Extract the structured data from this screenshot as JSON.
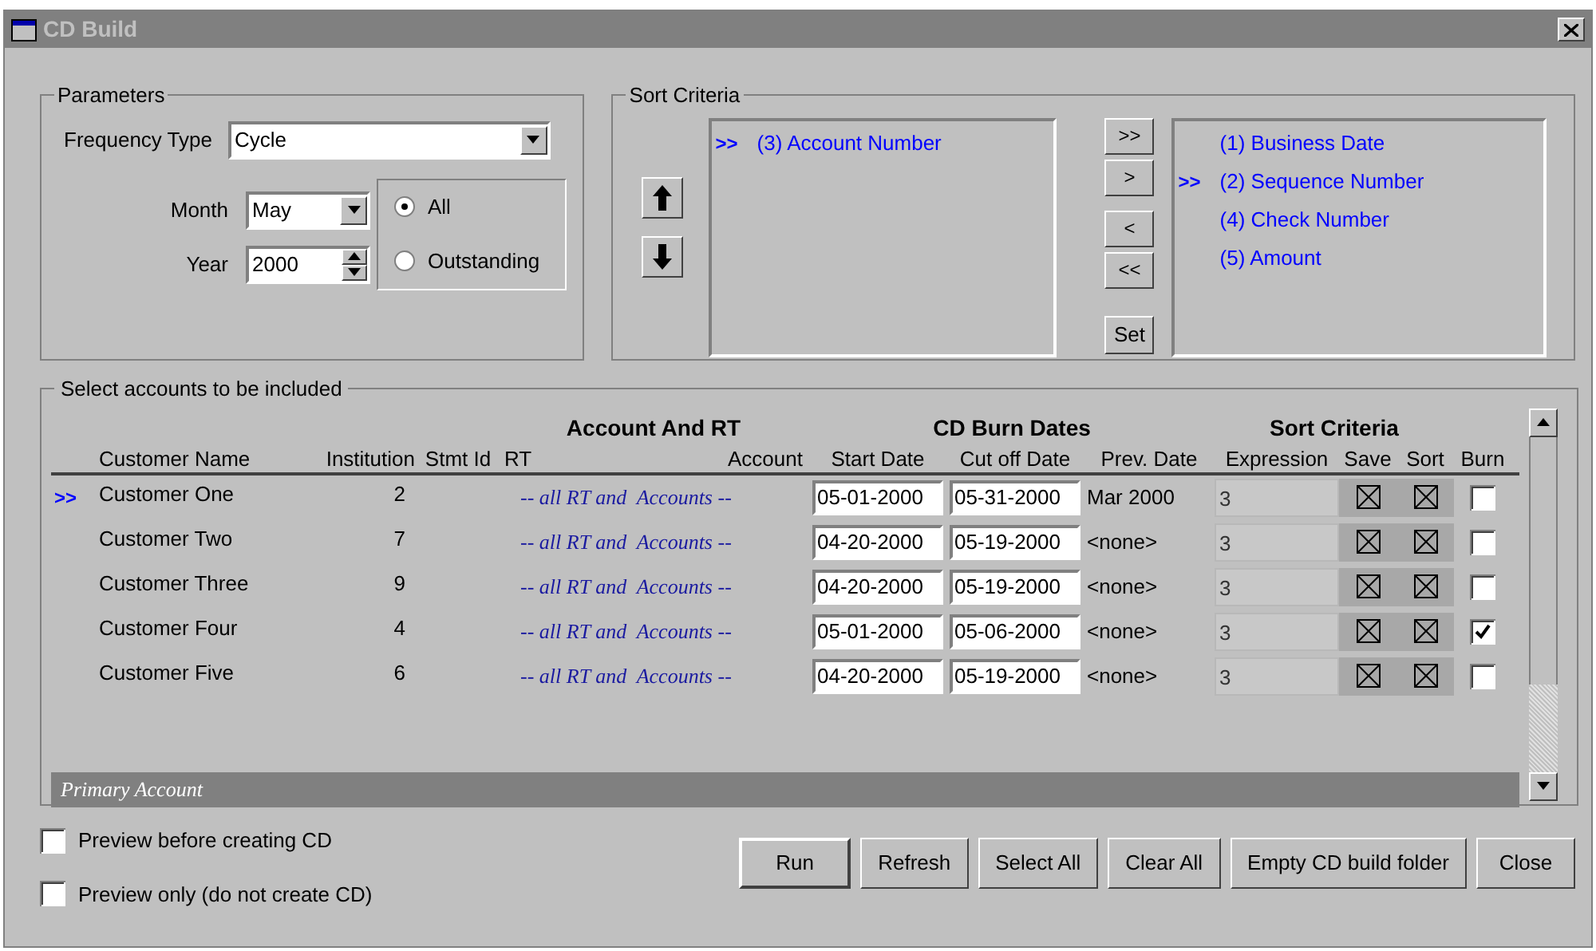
{
  "window": {
    "title": "CD Build"
  },
  "parameters": {
    "legend": "Parameters",
    "frequency_type": {
      "label": "Frequency Type",
      "value": "Cycle"
    },
    "month": {
      "label": "Month",
      "value": "May"
    },
    "year": {
      "label": "Year",
      "value": "2000"
    },
    "scope": [
      {
        "label": "All",
        "selected": true
      },
      {
        "label": "Outstanding",
        "selected": false
      }
    ]
  },
  "sort_criteria": {
    "legend": "Sort Criteria",
    "selected_list": [
      {
        "marker": ">>",
        "label": "(3) Account Number"
      }
    ],
    "move_buttons": [
      ">>",
      ">",
      "<",
      "<<"
    ],
    "set_button": "Set",
    "available_list": [
      {
        "label": "(1) Business Date"
      },
      {
        "marker": ">>",
        "label": "(2) Sequence Number"
      },
      {
        "label": "(4) Check Number"
      },
      {
        "label": "(5) Amount"
      }
    ]
  },
  "accounts": {
    "legend": "Select accounts to be included",
    "group_headers": [
      "Account And RT",
      "CD Burn Dates",
      "Sort Criteria"
    ],
    "columns": [
      "Customer Name",
      "Institution",
      "Stmt Id",
      "RT",
      "Account",
      "Start Date",
      "Cut off Date",
      "Prev. Date",
      "Expression",
      "Save",
      "Sort",
      "Burn"
    ],
    "rows": [
      {
        "marker": ">>",
        "name": "Customer One",
        "institution": "2",
        "rt_account": "-- all RT and  Accounts --",
        "start_date": "05-01-2000",
        "cutoff_date": "05-31-2000",
        "prev_date": "Mar 2000",
        "expression": "3",
        "save": true,
        "sort": true,
        "burn": false
      },
      {
        "name": "Customer Two",
        "institution": "7",
        "rt_account": "-- all RT and  Accounts --",
        "start_date": "04-20-2000",
        "cutoff_date": "05-19-2000",
        "prev_date": "<none>",
        "expression": "3",
        "save": true,
        "sort": true,
        "burn": false
      },
      {
        "name": "Customer Three",
        "institution": "9",
        "rt_account": "-- all RT and  Accounts --",
        "start_date": "04-20-2000",
        "cutoff_date": "05-19-2000",
        "prev_date": "<none>",
        "expression": "3",
        "save": true,
        "sort": true,
        "burn": false
      },
      {
        "name": "Customer Four",
        "institution": "4",
        "rt_account": "-- all RT and  Accounts --",
        "start_date": "05-01-2000",
        "cutoff_date": "05-06-2000",
        "prev_date": "<none>",
        "expression": "3",
        "save": true,
        "sort": true,
        "burn": true
      },
      {
        "name": "Customer Five",
        "institution": "6",
        "rt_account": "-- all RT and  Accounts --",
        "start_date": "04-20-2000",
        "cutoff_date": "05-19-2000",
        "prev_date": "<none>",
        "expression": "3",
        "save": true,
        "sort": true,
        "burn": false
      }
    ],
    "footer": "Primary Account"
  },
  "options": [
    {
      "label": "Preview before creating CD",
      "checked": false
    },
    {
      "label": "Preview only (do not create CD)",
      "checked": false
    }
  ],
  "buttons": [
    {
      "label": "Run",
      "default": true
    },
    {
      "label": "Refresh",
      "default": false
    },
    {
      "label": "Select All",
      "default": false
    },
    {
      "label": "Clear All",
      "default": false
    },
    {
      "label": "Empty CD build folder",
      "default": false
    },
    {
      "label": "Close",
      "default": false
    }
  ]
}
